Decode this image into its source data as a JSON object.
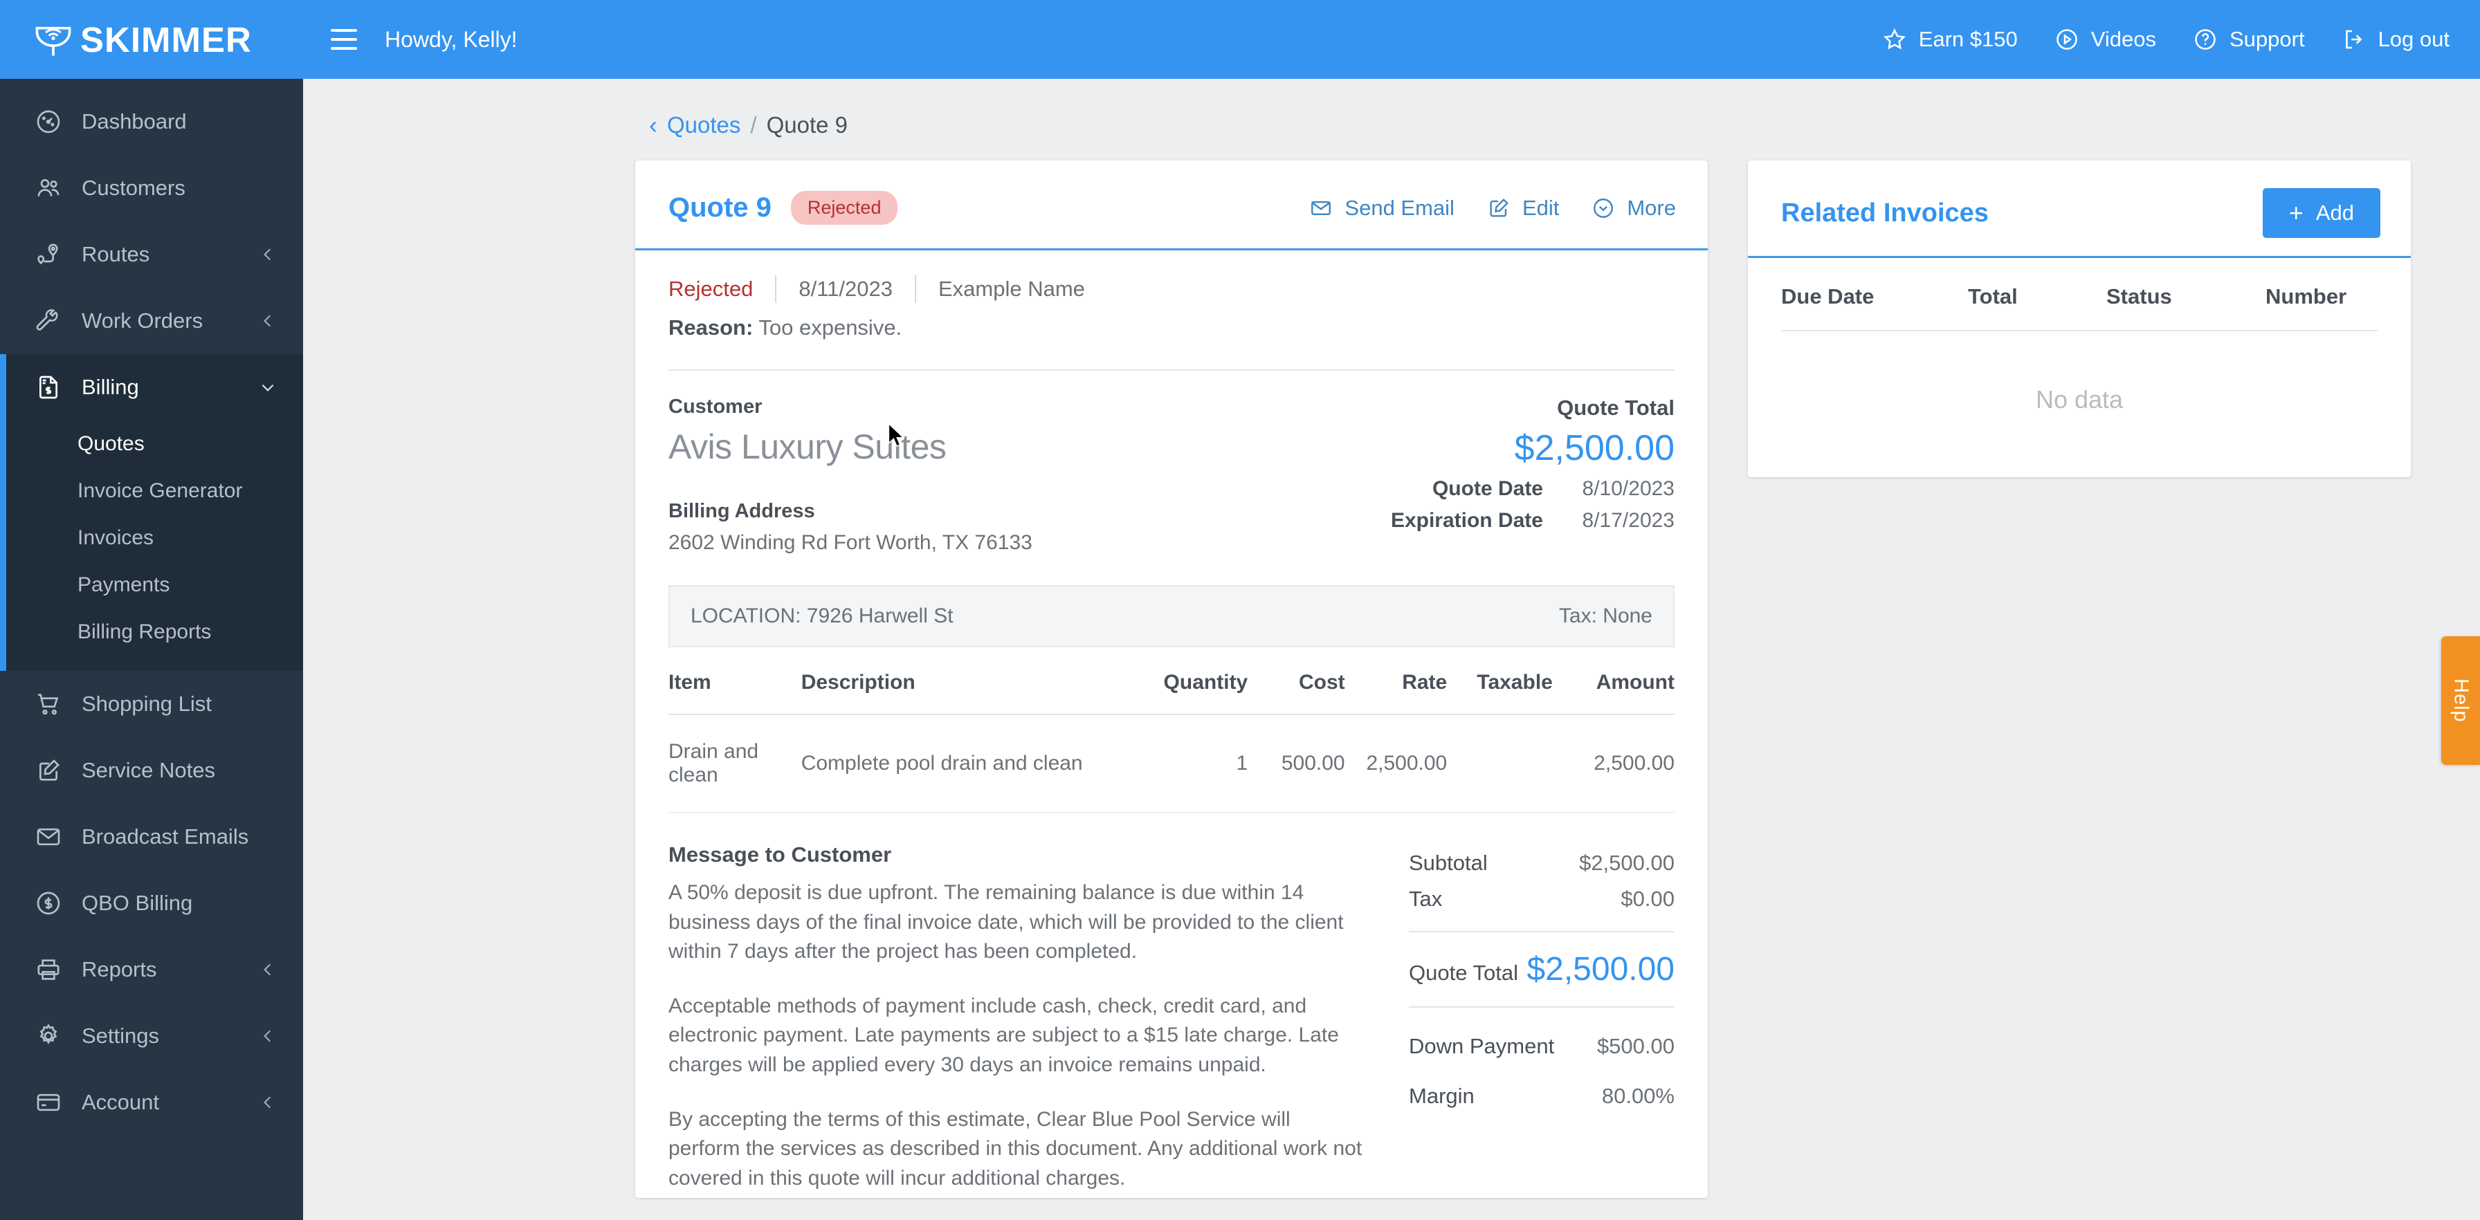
{
  "brand": {
    "name": "SKIMMER",
    "logo_icon": "skimmer-net-icon",
    "header_color": "#3494f0",
    "sidebar_color": "#263645",
    "accent": "#3494f0"
  },
  "topbar": {
    "menu_icon": "hamburger-icon",
    "greeting": "Howdy, Kelly!",
    "actions": [
      {
        "label": "Earn $150",
        "icon": "star-icon"
      },
      {
        "label": "Videos",
        "icon": "play-circle-icon"
      },
      {
        "label": "Support",
        "icon": "question-circle-icon"
      },
      {
        "label": "Log out",
        "icon": "logout-icon"
      }
    ]
  },
  "sidebar": {
    "items": [
      {
        "label": "Dashboard",
        "icon": "gauge-icon",
        "expandable": false,
        "active": false
      },
      {
        "label": "Customers",
        "icon": "users-icon",
        "expandable": false,
        "active": false
      },
      {
        "label": "Routes",
        "icon": "route-pin-icon",
        "expandable": true,
        "active": false
      },
      {
        "label": "Work Orders",
        "icon": "wrench-icon",
        "expandable": true,
        "active": false
      },
      {
        "label": "Billing",
        "icon": "invoice-dollar-icon",
        "expandable": true,
        "active": true
      },
      {
        "label": "Shopping List",
        "icon": "cart-icon",
        "expandable": false,
        "active": false
      },
      {
        "label": "Service Notes",
        "icon": "note-pencil-icon",
        "expandable": false,
        "active": false
      },
      {
        "label": "Broadcast Emails",
        "icon": "envelope-icon",
        "expandable": false,
        "active": false
      },
      {
        "label": "QBO Billing",
        "icon": "dollar-circle-icon",
        "expandable": false,
        "active": false
      },
      {
        "label": "Reports",
        "icon": "printer-icon",
        "expandable": true,
        "active": false
      },
      {
        "label": "Settings",
        "icon": "gear-icon",
        "expandable": true,
        "active": false
      },
      {
        "label": "Account",
        "icon": "credit-card-icon",
        "expandable": true,
        "active": false
      }
    ],
    "billing_submenu": [
      {
        "label": "Quotes",
        "active": true
      },
      {
        "label": "Invoice Generator",
        "active": false
      },
      {
        "label": "Invoices",
        "active": false
      },
      {
        "label": "Payments",
        "active": false
      },
      {
        "label": "Billing Reports",
        "active": false
      }
    ]
  },
  "breadcrumb": {
    "back_icon": "chevron-left-icon",
    "parent": "Quotes",
    "separator": "/",
    "current": "Quote 9"
  },
  "quote": {
    "title": "Quote 9",
    "status_badge": "Rejected",
    "badge_bg": "#f7c3c3",
    "badge_fg": "#b2332f",
    "actions": [
      {
        "label": "Send Email",
        "icon": "envelope-icon"
      },
      {
        "label": "Edit",
        "icon": "pencil-square-icon"
      },
      {
        "label": "More",
        "icon": "chevron-down-circle-icon"
      }
    ],
    "rejection": {
      "status": "Rejected",
      "date": "8/11/2023",
      "name": "Example Name",
      "reason_label": "Reason:",
      "reason_text": "Too expensive."
    },
    "customer_label": "Customer",
    "customer_name": "Avis Luxury Suites",
    "billing_address_label": "Billing Address",
    "billing_address": "2602 Winding Rd Fort Worth, TX 76133",
    "quote_total_label": "Quote Total",
    "quote_total_value": "$2,500.00",
    "quote_date_label": "Quote Date",
    "quote_date_value": "8/10/2023",
    "expiration_date_label": "Expiration Date",
    "expiration_date_value": "8/17/2023",
    "location_text": "LOCATION: 7926 Harwell St",
    "tax_text": "Tax: None",
    "table": {
      "headers": [
        "Item",
        "Description",
        "Quantity",
        "Cost",
        "Rate",
        "Taxable",
        "Amount"
      ],
      "rows": [
        {
          "item": "Drain and clean",
          "description": "Complete pool drain and clean",
          "quantity": "1",
          "cost": "500.00",
          "rate": "2,500.00",
          "taxable": "",
          "amount": "2,500.00"
        }
      ]
    },
    "message_title": "Message to Customer",
    "message_paragraphs": [
      "A 50% deposit is due upfront. The remaining balance is due within 14 business days of the final invoice date, which will be provided to the client within 7 days after the project has been completed.",
      "Acceptable methods of payment include cash, check, credit card, and electronic payment. Late payments are subject to a $15 late charge. Late charges will be applied every 30 days an invoice remains unpaid.",
      "By accepting the terms of this estimate, Clear Blue Pool Service will perform the services as described in this document. Any additional work not covered in this quote will incur additional charges."
    ],
    "totals": {
      "subtotal_label": "Subtotal",
      "subtotal_value": "$2,500.00",
      "tax_label": "Tax",
      "tax_value": "$0.00",
      "total_label": "Quote Total",
      "total_value": "$2,500.00",
      "down_payment_label": "Down Payment",
      "down_payment_value": "$500.00",
      "margin_label": "Margin",
      "margin_value": "80.00%"
    }
  },
  "related_invoices": {
    "title": "Related Invoices",
    "add_label": "Add",
    "add_icon": "plus-icon",
    "headers": [
      "Due Date",
      "Total",
      "Status",
      "Number"
    ],
    "empty_text": "No data"
  },
  "help_tab": {
    "label": "Help",
    "color": "#f29122"
  }
}
